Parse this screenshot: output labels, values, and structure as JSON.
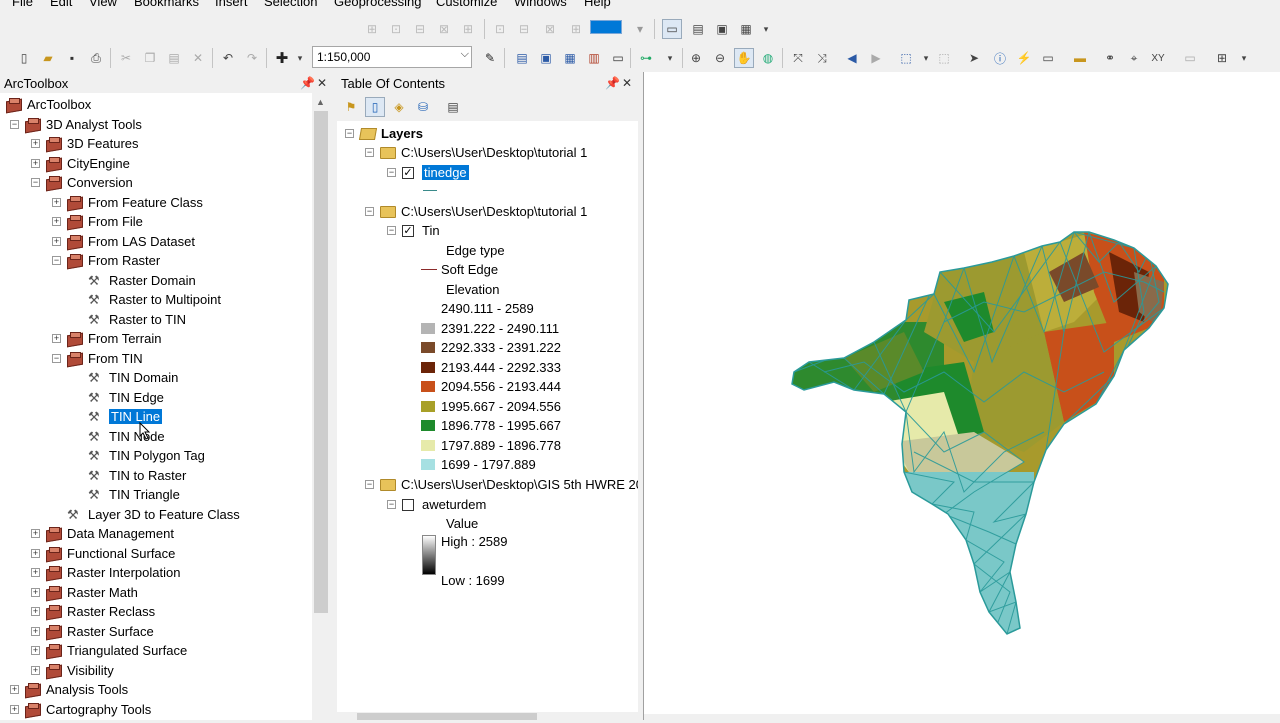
{
  "menu": [
    "File",
    "Edit",
    "View",
    "Bookmarks",
    "Insert",
    "Selection",
    "Geoprocessing",
    "Customize",
    "Windows",
    "Help"
  ],
  "scale": {
    "value": "1:150,000"
  },
  "arctoolbox": {
    "title": "ArcToolbox",
    "items": [
      {
        "label": "ArcToolbox"
      },
      {
        "label": "3D Analyst Tools"
      },
      {
        "label": "3D Features"
      },
      {
        "label": "CityEngine"
      },
      {
        "label": "Conversion"
      },
      {
        "label": "From Feature Class"
      },
      {
        "label": "From File"
      },
      {
        "label": "From LAS Dataset"
      },
      {
        "label": "From Raster"
      },
      {
        "label": "Raster Domain"
      },
      {
        "label": "Raster to Multipoint"
      },
      {
        "label": "Raster to TIN"
      },
      {
        "label": "From Terrain"
      },
      {
        "label": "From TIN"
      },
      {
        "label": "TIN Domain"
      },
      {
        "label": "TIN Edge"
      },
      {
        "label": "TIN Line"
      },
      {
        "label": "TIN Node"
      },
      {
        "label": "TIN Polygon Tag"
      },
      {
        "label": "TIN to Raster"
      },
      {
        "label": "TIN Triangle"
      },
      {
        "label": "Layer 3D to Feature Class"
      },
      {
        "label": "Data Management"
      },
      {
        "label": "Functional Surface"
      },
      {
        "label": "Raster Interpolation"
      },
      {
        "label": "Raster Math"
      },
      {
        "label": "Raster Reclass"
      },
      {
        "label": "Raster Surface"
      },
      {
        "label": "Triangulated Surface"
      },
      {
        "label": "Visibility"
      },
      {
        "label": "Analysis Tools"
      },
      {
        "label": "Cartography Tools"
      }
    ]
  },
  "toc": {
    "title": "Table Of Contents",
    "layers_label": "Layers",
    "group1": "C:\\Users\\User\\Desktop\\tutorial 1",
    "layer_tinedge": "tinedge",
    "group2": "C:\\Users\\User\\Desktop\\tutorial 1",
    "layer_tin": "Tin",
    "edge_type": "Edge type",
    "soft_edge": "Soft Edge",
    "elevation": "Elevation",
    "classes": [
      {
        "label": "2490.111 - 2589",
        "color": "#ffffff"
      },
      {
        "label": "2391.222 - 2490.111",
        "color": "#b4b4b4"
      },
      {
        "label": "2292.333 - 2391.222",
        "color": "#7a4a2a"
      },
      {
        "label": "2193.444 - 2292.333",
        "color": "#6b2408"
      },
      {
        "label": "2094.556 - 2193.444",
        "color": "#c8501a"
      },
      {
        "label": "1995.667 - 2094.556",
        "color": "#a8a028"
      },
      {
        "label": "1896.778 - 1995.667",
        "color": "#1e8a2c"
      },
      {
        "label": "1797.889 - 1896.778",
        "color": "#e6eaaa"
      },
      {
        "label": "1699 - 1797.889",
        "color": "#a6e0e2"
      }
    ],
    "group3": "C:\\Users\\User\\Desktop\\GIS 5th HWRE 20",
    "layer_dem": "aweturdem",
    "value_label": "Value",
    "high_label": "High : 2589",
    "low_label": "Low : 1699"
  }
}
